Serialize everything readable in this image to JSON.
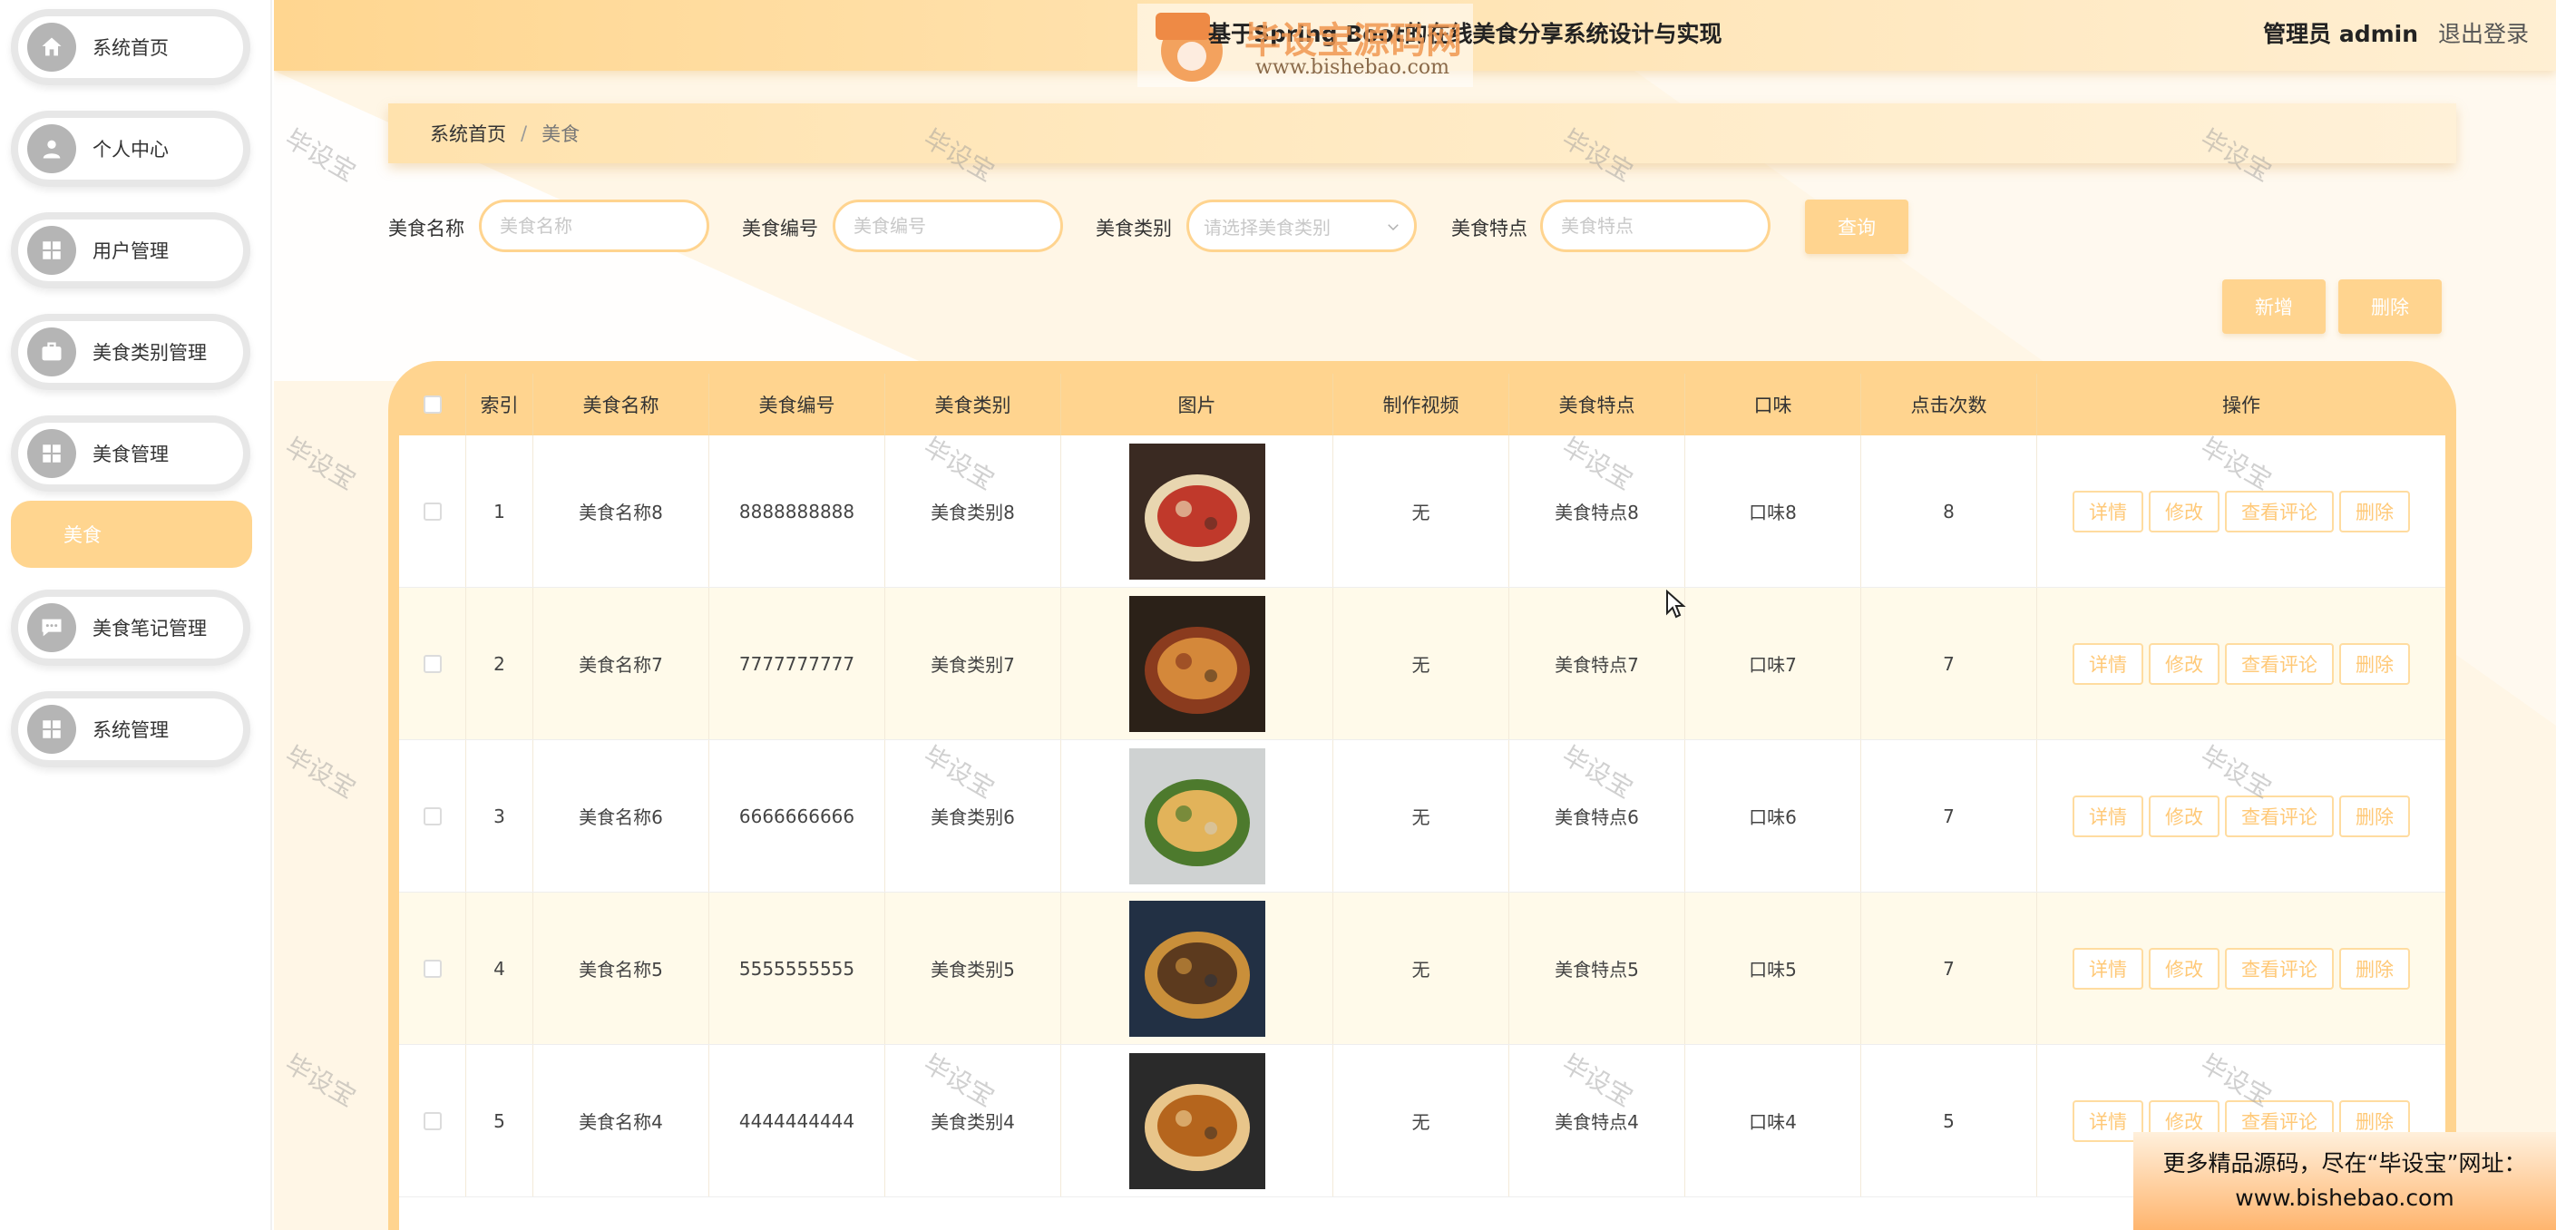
{
  "sidebar": {
    "items": [
      {
        "label": "系统首页",
        "icon": "home-icon"
      },
      {
        "label": "个人中心",
        "icon": "user-icon"
      },
      {
        "label": "用户管理",
        "icon": "grid-icon"
      },
      {
        "label": "美食类别管理",
        "icon": "briefcase-icon"
      },
      {
        "label": "美食管理",
        "icon": "grid-icon"
      },
      {
        "label": "美食笔记管理",
        "icon": "chat-icon"
      },
      {
        "label": "系统管理",
        "icon": "grid-icon"
      }
    ],
    "active_sub": "美食"
  },
  "header": {
    "title": "基于Spring Boot的在线美食分享系统设计与实现",
    "user": "管理员 admin",
    "logout": "退出登录",
    "logo_text": "毕设宝源码网",
    "logo_url": "www.bishebao.com"
  },
  "breadcrumb": {
    "home": "系统首页",
    "sep": "/",
    "current": "美食"
  },
  "search": {
    "name_label": "美食名称",
    "name_placeholder": "美食名称",
    "code_label": "美食编号",
    "code_placeholder": "美食编号",
    "category_label": "美食类别",
    "category_placeholder": "请选择美食类别",
    "feature_label": "美食特点",
    "feature_placeholder": "美食特点",
    "query_button": "查询"
  },
  "actions": {
    "add": "新增",
    "delete": "删除"
  },
  "table": {
    "headers": [
      "索引",
      "美食名称",
      "美食编号",
      "美食类别",
      "图片",
      "制作视频",
      "美食特点",
      "口味",
      "点击次数",
      "操作"
    ],
    "row_actions": [
      "详情",
      "修改",
      "查看评论",
      "删除"
    ],
    "rows": [
      {
        "index": "1",
        "name": "美食名称8",
        "code": "8888888888",
        "category": "美食类别8",
        "video": "无",
        "feature": "美食特点8",
        "taste": "口味8",
        "clicks": "8"
      },
      {
        "index": "2",
        "name": "美食名称7",
        "code": "7777777777",
        "category": "美食类别7",
        "video": "无",
        "feature": "美食特点7",
        "taste": "口味7",
        "clicks": "7"
      },
      {
        "index": "3",
        "name": "美食名称6",
        "code": "6666666666",
        "category": "美食类别6",
        "video": "无",
        "feature": "美食特点6",
        "taste": "口味6",
        "clicks": "7"
      },
      {
        "index": "4",
        "name": "美食名称5",
        "code": "5555555555",
        "category": "美食类别5",
        "video": "无",
        "feature": "美食特点5",
        "taste": "口味5",
        "clicks": "7"
      },
      {
        "index": "5",
        "name": "美食名称4",
        "code": "4444444444",
        "category": "美食类别4",
        "video": "无",
        "feature": "美食特点4",
        "taste": "口味4",
        "clicks": "5"
      }
    ]
  },
  "watermark": "毕设宝",
  "ad": {
    "line1": "更多精品源码，尽在“毕设宝”网址：",
    "line2": "www.bishebao.com"
  },
  "colors": {
    "accent": "#ffd48f",
    "header": "#ffd690",
    "background": "#fff6e6"
  }
}
